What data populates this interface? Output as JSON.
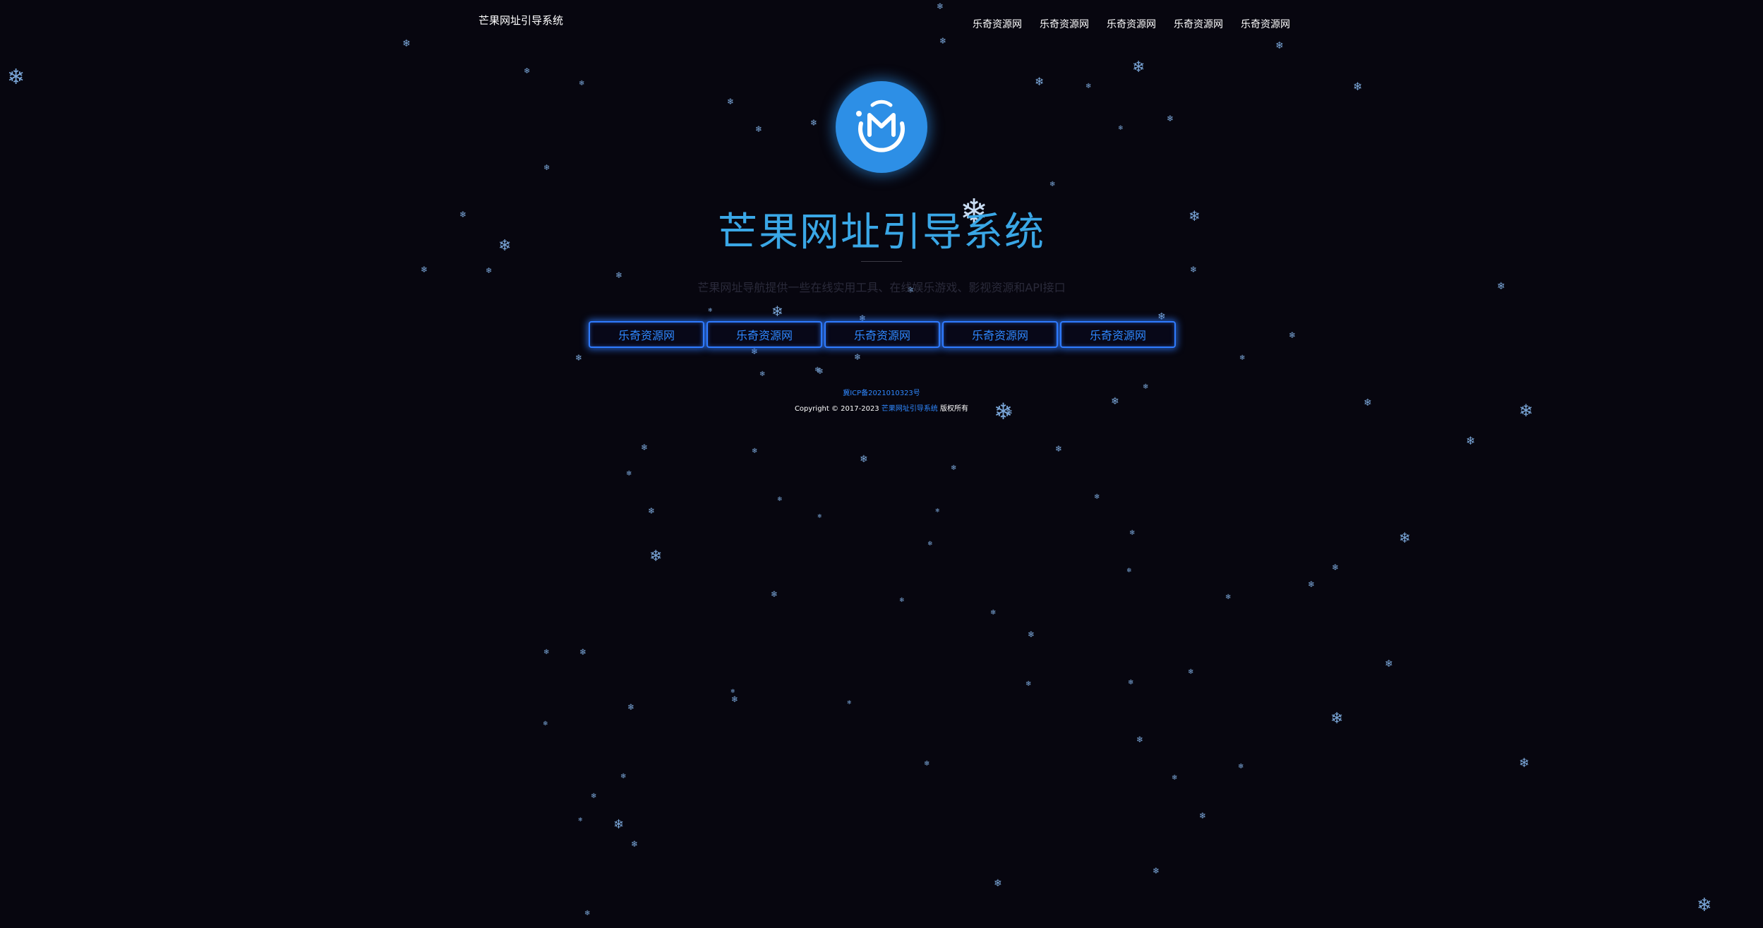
{
  "header": {
    "site_title": "芒果网址引导系统",
    "nav": [
      "乐奇资源网",
      "乐奇资源网",
      "乐奇资源网",
      "乐奇资源网",
      "乐奇资源网"
    ]
  },
  "hero": {
    "title": "芒果网址引导系统",
    "description": "芒果网址导航提供一些在线实用工具、在线娱乐游戏、影视资源和API接口"
  },
  "buttons": [
    "乐奇资源网",
    "乐奇资源网",
    "乐奇资源网",
    "乐奇资源网",
    "乐奇资源网"
  ],
  "footer": {
    "icp": "冀ICP备2021010323号",
    "copyright_prefix": "Copyright © 2017-2023",
    "copyright_brand": "芒果网址引导系统",
    "copyright_suffix": "版权所有"
  },
  "colors": {
    "background": "#07060f",
    "accent": "#2f88ff",
    "title": "#3aa7e6",
    "logo": "#2d8fe6",
    "snow": "#7aa6d8"
  },
  "icons": {
    "logo": "mango-logo-icon",
    "snow": "snowflake-icon"
  }
}
